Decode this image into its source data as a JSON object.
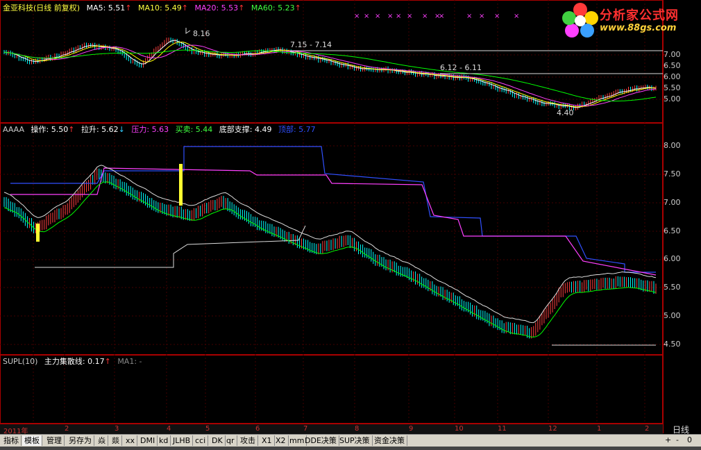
{
  "main_panel": {
    "stock": "金亚科技(日线 前复权)",
    "ma5_label": "MA5: 5.51",
    "ma10_label": "MA10: 5.49",
    "ma20_label": "MA20: 5.53",
    "ma60_label": "MA60: 5.23",
    "y_ticks": [
      "7.00",
      "6.50",
      "6.00",
      "5.50",
      "5.00"
    ],
    "annotations": [
      "8.16",
      "7.15 - 7.14",
      "6.12 - 6.11",
      "4.40"
    ]
  },
  "indicator_panel": {
    "name": "AAAA",
    "op_label": "操作: 5.50",
    "pull_label": "拉升: 5.62",
    "press_label": "压力: 5.63",
    "trade_label": "买卖: 5.44",
    "support_label": "底部支撑: 4.49",
    "top_label": "顶部: 5.77",
    "y_ticks": [
      "8.00",
      "7.50",
      "7.00",
      "6.50",
      "6.00",
      "5.50",
      "5.00",
      "4.50"
    ]
  },
  "supl_panel": {
    "name": "SUPL(10)",
    "line_label": "主力集散线: 0.17",
    "ma_label": "MA1: -"
  },
  "x_axis": {
    "months": [
      "2011年",
      "2",
      "3",
      "4",
      "5",
      "6",
      "7",
      "8",
      "9",
      "10",
      "11",
      "12",
      "1",
      "2"
    ],
    "period": "日线"
  },
  "logo": {
    "name": "分析家公式网",
    "url": "www.88gs.com"
  },
  "tabs": [
    "指标",
    "模板",
    "管理",
    "另存为",
    "焱",
    "燚",
    "xx",
    "DMI",
    "kd",
    "JLHB",
    "cci",
    "DK",
    "qr",
    "攻击",
    "X1",
    "X2",
    "mm",
    "DDE决策",
    "SUP决策",
    "资金决策"
  ],
  "tab_controls": [
    "+",
    "-",
    "0"
  ],
  "colors": {
    "ma5": "#ffffff",
    "ma10": "#ffff00",
    "ma20": "#ff40ff",
    "ma60": "#00ff00",
    "up": "#ff4040",
    "down": "#00ffff",
    "press": "#ff40ff",
    "trade": "#00ff00",
    "top": "#3050ff"
  }
}
